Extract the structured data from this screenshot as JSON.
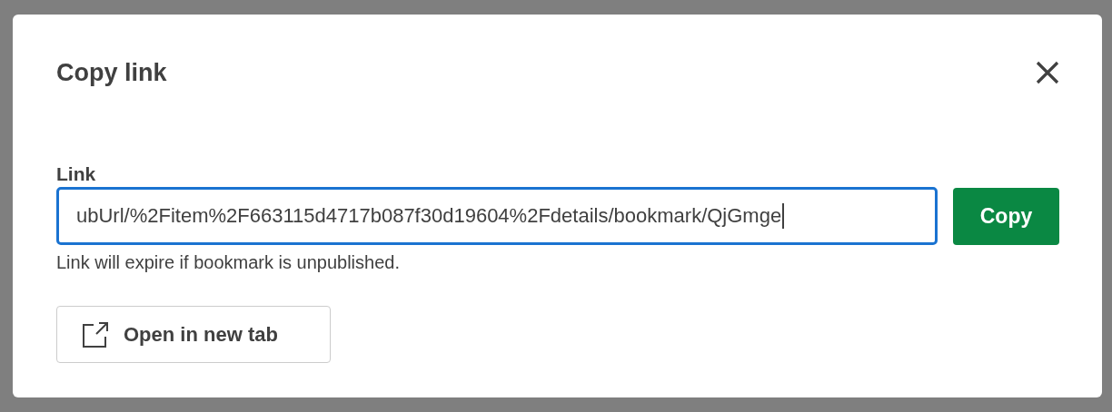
{
  "dialog": {
    "title": "Copy link"
  },
  "link_field": {
    "label": "Link",
    "value": "ubUrl/%2Fitem%2F663115d4717b087f30d19604%2Fdetails/bookmark/QjGmge",
    "focused": true
  },
  "copy_button": {
    "label": "Copy"
  },
  "helper_text": "Link will expire if bookmark is unpublished.",
  "open_button": {
    "label": "Open in new tab"
  }
}
